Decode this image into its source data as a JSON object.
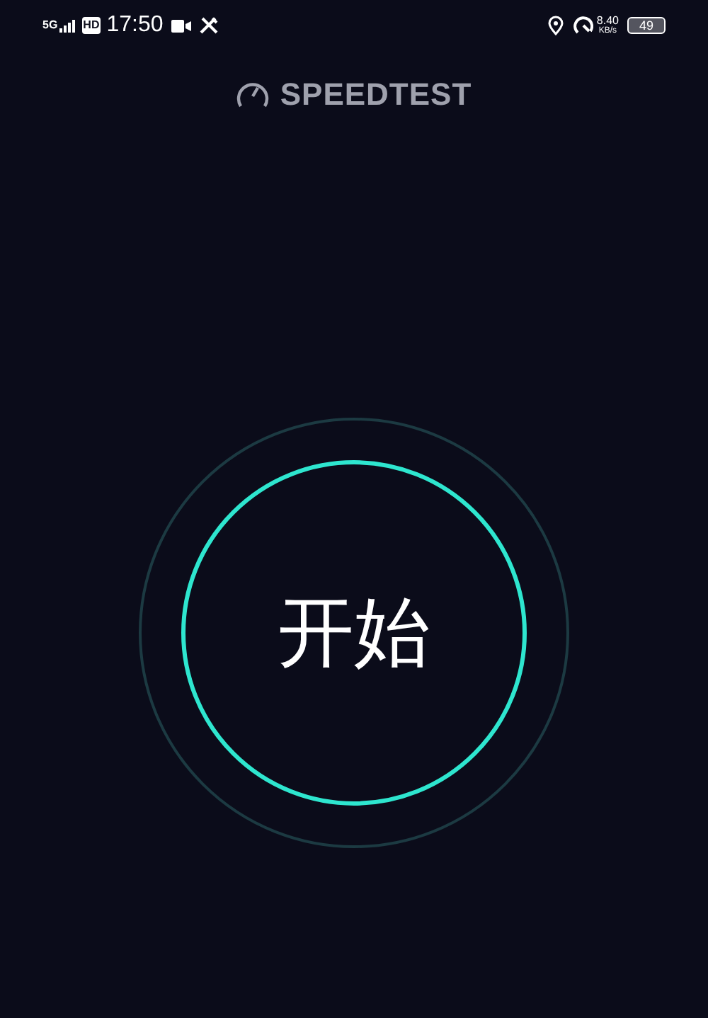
{
  "status_bar": {
    "network": "5G",
    "hd": "HD",
    "time": "17:50",
    "speed": "8.40",
    "speed_unit": "KB/s",
    "battery": "49"
  },
  "header": {
    "title": "SPEEDTEST"
  },
  "start_button": {
    "label": "开始"
  }
}
